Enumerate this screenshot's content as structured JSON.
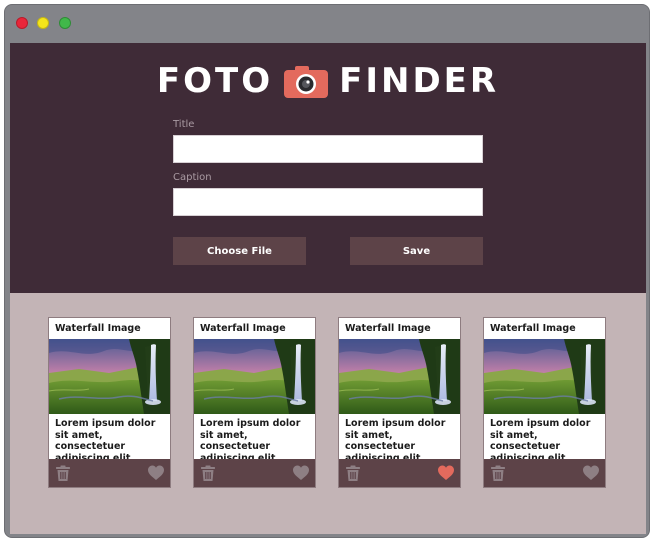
{
  "window": {
    "controls": [
      "close",
      "minimize",
      "maximize"
    ]
  },
  "header": {
    "logo_left": "FOTO",
    "logo_right": "FINDER",
    "logo_icon": "camera-icon",
    "title_label": "Title",
    "title_value": "",
    "caption_label": "Caption",
    "caption_value": "",
    "choose_file_label": "Choose File",
    "save_label": "Save"
  },
  "colors": {
    "header_bg": "#3f2b37",
    "gallery_bg": "#c3b4b6",
    "button_bg": "#5d4348",
    "accent": "#e36a5d",
    "icon_muted": "#8e7f84"
  },
  "cards": [
    {
      "title": "Waterfall Image",
      "caption": "Lorem ipsum dolor sit amet, consectetuer adipiscing elit.",
      "favorited": false,
      "image": "waterfall-landscape"
    },
    {
      "title": "Waterfall Image",
      "caption": "Lorem ipsum dolor sit amet, consectetuer adipiscing elit.",
      "favorited": false,
      "image": "waterfall-landscape"
    },
    {
      "title": "Waterfall Image",
      "caption": "Lorem ipsum dolor sit amet, consectetuer adipiscing elit.",
      "favorited": true,
      "image": "waterfall-landscape"
    },
    {
      "title": "Waterfall Image",
      "caption": "Lorem ipsum dolor sit amet, consectetuer adipiscing elit.",
      "favorited": false,
      "image": "waterfall-landscape"
    }
  ]
}
